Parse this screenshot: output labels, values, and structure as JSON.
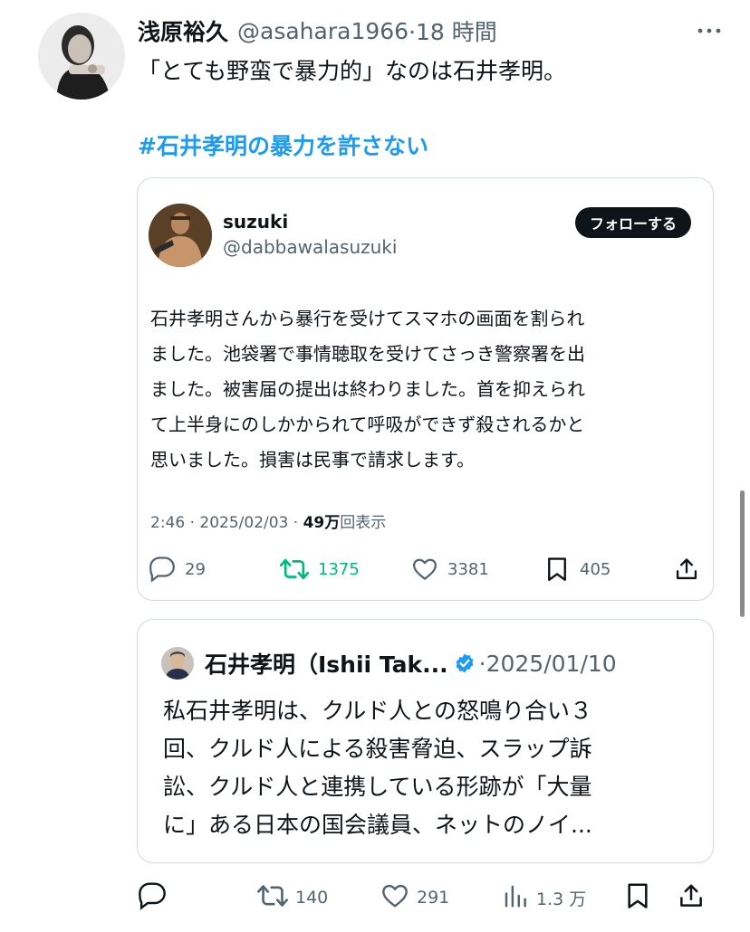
{
  "tweet": {
    "author_name": "浅原裕久",
    "author_handle": "@asahara1966",
    "time": "·18 時間",
    "text": "「とても野蛮で暴力的」なのは石井孝明。",
    "hashtag": "#石井孝明の暴力を許さない"
  },
  "embedded": {
    "name": "suzuki",
    "handle": "@dabbawalasuzuki",
    "follow_label": "フォローする",
    "body_lines": [
      "石井孝明さんから暴行を受けてスマホの画面を割られ",
      "ました。池袋署で事情聴取を受けてさっき警察署を出",
      "ました。被害届の提出は終わりました。首を抑えられ",
      "て上半身にのしかかられて呼吸ができず殺されるかと",
      "思いました。損害は民事で請求します。"
    ],
    "meta_time": "2:46 · 2025/02/03 · ",
    "meta_views": "49万",
    "meta_views_suffix": "回表示",
    "replies": "29",
    "retweets": "1375",
    "likes": "3381",
    "bookmarks": "405"
  },
  "quoted": {
    "name": "石井孝明（Ishii Tak...",
    "date": "·2025/01/10",
    "body_lines": [
      "私石井孝明は、クルド人との怒鳴り合い３",
      "回、クルド人による殺害脅迫、スラップ訴",
      "訟、クルド人と連携している形跡が「大量",
      "に」ある日本の国会議員、ネットのノイ..."
    ]
  },
  "actions": {
    "retweets": "140",
    "likes": "291",
    "views": "1.3 万"
  },
  "colors": {
    "text": "#0f1419",
    "secondary": "#536471",
    "link": "#1d9bf0",
    "retweet_green": "#00ba7c",
    "border": "#cfd9de"
  },
  "icons": [
    "more-icon",
    "reply-icon",
    "retweet-icon",
    "like-icon",
    "bookmark-icon",
    "share-icon",
    "views-icon",
    "verified-badge-icon"
  ]
}
